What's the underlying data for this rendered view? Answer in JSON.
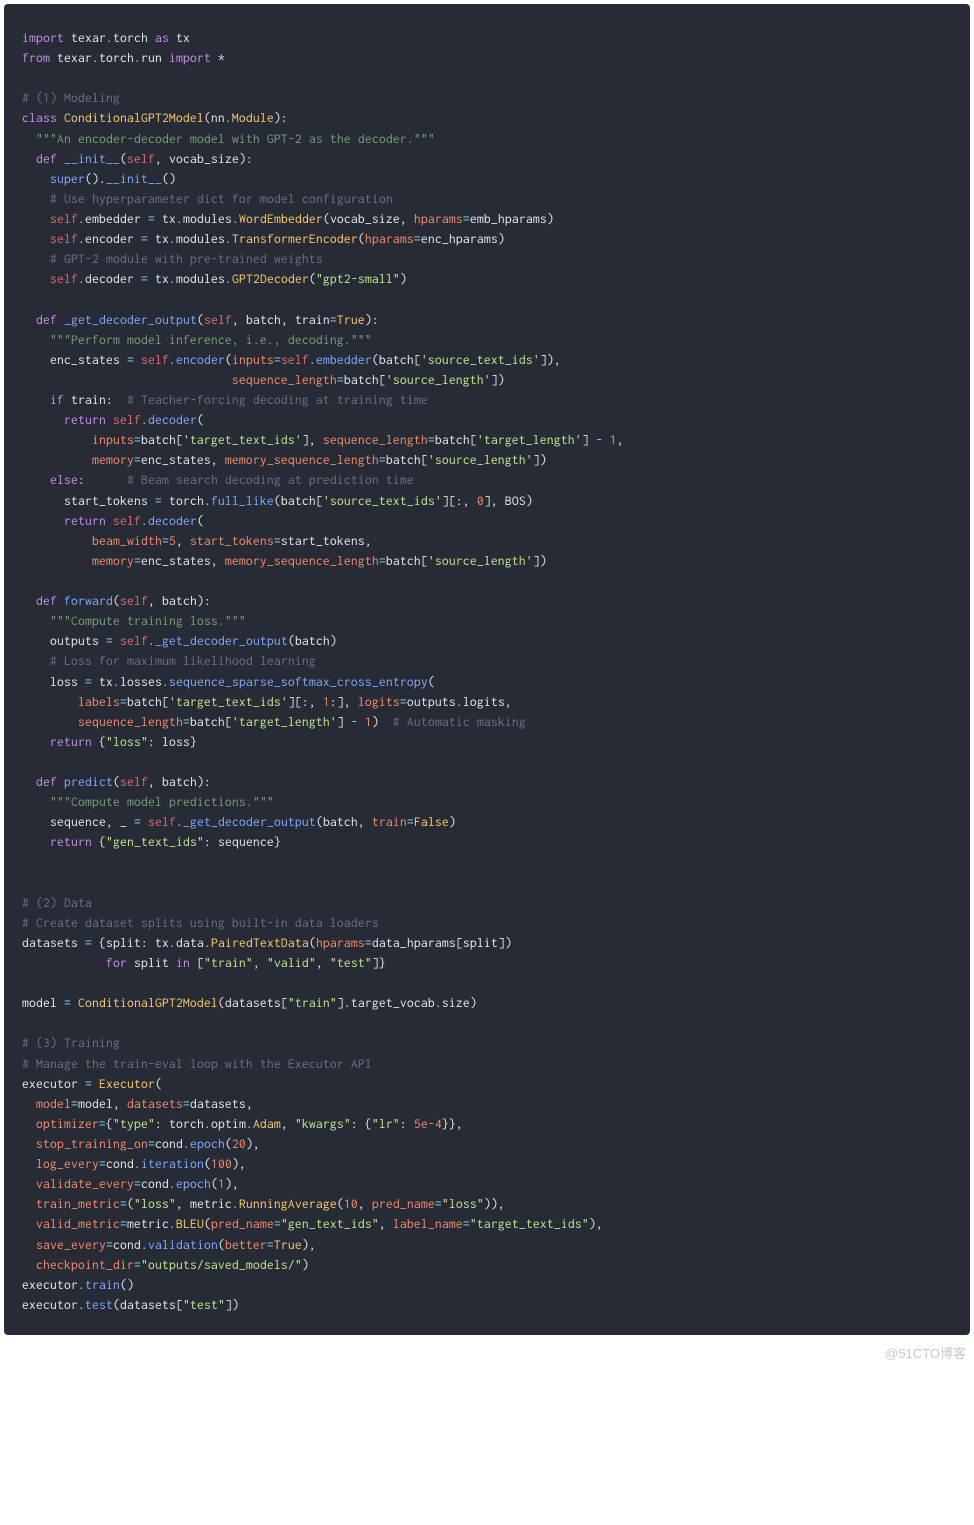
{
  "watermark": "@51CTO博客",
  "code": {
    "l01": {
      "kw1": "import",
      "id1": " texar",
      "op1": ".",
      "id2": "torch ",
      "kw2": "as",
      "id3": " tx"
    },
    "l02": {
      "kw1": "from",
      "id1": " texar",
      "op1": ".",
      "id2": "torch",
      "op2": ".",
      "id3": "run ",
      "kw2": "import",
      "id4": " *"
    },
    "l04": {
      "cmt": "# (1) Modeling"
    },
    "l05": {
      "kw": "class",
      "name": "ConditionalGPT2Model",
      "base1": "nn",
      "base2": "Module"
    },
    "l06": {
      "doc": "\"\"\"An encoder-decoder model with GPT-2 as the decoder.\"\"\""
    },
    "l07": {
      "kw": "def",
      "name": "__init__",
      "p1": "self",
      "p2": "vocab_size"
    },
    "l08": {
      "fn1": "super",
      "fn2": "__init__"
    },
    "l09": {
      "cmt": "# Use hyperparameter dict for model configuration"
    },
    "l10": {
      "lhs": "embedder",
      "m1": "tx",
      "m2": "modules",
      "m3": "WordEmbedder",
      "a1": "vocab_size",
      "kw": "hparams",
      "a2": "emb_hparams"
    },
    "l11": {
      "lhs": "encoder",
      "m1": "tx",
      "m2": "modules",
      "m3": "TransformerEncoder",
      "kw": "hparams",
      "a1": "enc_hparams"
    },
    "l12": {
      "cmt": "# GPT-2 module with pre-trained weights"
    },
    "l13": {
      "lhs": "decoder",
      "m1": "tx",
      "m2": "modules",
      "m3": "GPT2Decoder",
      "str": "\"gpt2-small\""
    },
    "l15": {
      "kw": "def",
      "name": "_get_decoder_output",
      "p1": "self",
      "p2": "batch",
      "p3": "train",
      "dv": "True"
    },
    "l16": {
      "doc": "\"\"\"Perform model inference, i.e., decoding.\"\"\""
    },
    "l17": {
      "lhs": "enc_states",
      "s": "self",
      "enc": "encoder",
      "kw1": "inputs",
      "emb": "embedder",
      "a1": "batch",
      "str1": "'source_text_ids'"
    },
    "l18": {
      "kw": "sequence_length",
      "a": "batch",
      "str": "'source_length'"
    },
    "l19": {
      "kw": "if",
      "id": "train",
      "cmt": "# Teacher-forcing decoding at training time"
    },
    "l20": {
      "kw": "return",
      "s": "self",
      "fn": "decoder"
    },
    "l21": {
      "kw1": "inputs",
      "a1": "batch",
      "str1": "'target_text_ids'",
      "kw2": "sequence_length",
      "a2": "batch",
      "str2": "'target_length'",
      "n": "1"
    },
    "l22": {
      "kw1": "memory",
      "id1": "enc_states",
      "kw2": "memory_sequence_length",
      "a": "batch",
      "str": "'source_length'"
    },
    "l23": {
      "kw": "else",
      "cmt": "# Beam search decoding at prediction time"
    },
    "l24": {
      "lhs": "start_tokens",
      "m1": "torch",
      "fn": "full_like",
      "a": "batch",
      "str": "'source_text_ids'",
      "n": "0",
      "id2": "BOS"
    },
    "l25": {
      "kw": "return",
      "s": "self",
      "fn": "decoder"
    },
    "l26": {
      "kw1": "beam_width",
      "n": "5",
      "kw2": "start_tokens",
      "id": "start_tokens"
    },
    "l27": {
      "kw1": "memory",
      "id1": "enc_states",
      "kw2": "memory_sequence_length",
      "a": "batch",
      "str": "'source_length'"
    },
    "l29": {
      "kw": "def",
      "name": "forward",
      "p1": "self",
      "p2": "batch"
    },
    "l30": {
      "doc": "\"\"\"Compute training loss.\"\"\""
    },
    "l31": {
      "lhs": "outputs",
      "s": "self",
      "fn": "_get_decoder_output",
      "a": "batch"
    },
    "l32": {
      "cmt": "# Loss for maximum likelihood learning"
    },
    "l33": {
      "lhs": "loss",
      "m1": "tx",
      "m2": "losses",
      "fn": "sequence_sparse_softmax_cross_entropy"
    },
    "l34": {
      "kw1": "labels",
      "a1": "batch",
      "str1": "'target_text_ids'",
      "n": "1",
      "kw2": "logits",
      "id2": "outputs",
      "attr": "logits"
    },
    "l35": {
      "kw": "sequence_length",
      "a": "batch",
      "str": "'target_length'",
      "n": "1",
      "cmt": "# Automatic masking"
    },
    "l36": {
      "kw": "return",
      "str": "\"loss\"",
      "id": "loss"
    },
    "l38": {
      "kw": "def",
      "name": "predict",
      "p1": "self",
      "p2": "batch"
    },
    "l39": {
      "doc": "\"\"\"Compute model predictions.\"\"\""
    },
    "l40": {
      "lhs1": "sequence",
      "lhs2": "_",
      "s": "self",
      "fn": "_get_decoder_output",
      "a": "batch",
      "kw": "train",
      "dv": "False"
    },
    "l41": {
      "kw": "return",
      "str": "\"gen_text_ids\"",
      "id": "sequence"
    },
    "l44": {
      "cmt": "# (2) Data"
    },
    "l45": {
      "cmt": "# Create dataset splits using built-in data loaders"
    },
    "l46": {
      "lhs": "datasets",
      "id1": "split",
      "m1": "tx",
      "m2": "data",
      "cls": "PairedTextData",
      "kw": "hparams",
      "id2": "data_hparams",
      "id3": "split"
    },
    "l47": {
      "kw1": "for",
      "id": "split",
      "kw2": "in",
      "s1": "\"train\"",
      "s2": "\"valid\"",
      "s3": "\"test\""
    },
    "l49": {
      "lhs": "model",
      "cls": "ConditionalGPT2Model",
      "id": "datasets",
      "str": "\"train\"",
      "a1": "target_vocab",
      "a2": "size"
    },
    "l51": {
      "cmt": "# (3) Training"
    },
    "l52": {
      "cmt": "# Manage the train-eval loop with the Executor API"
    },
    "l53": {
      "lhs": "executor",
      "cls": "Executor"
    },
    "l54": {
      "kw1": "model",
      "id1": "model",
      "kw2": "datasets",
      "id2": "datasets"
    },
    "l55": {
      "kw1": "optimizer",
      "s1": "\"type\"",
      "m1": "torch",
      "m2": "optim",
      "cls": "Adam",
      "s2": "\"kwargs\"",
      "s3": "\"lr\"",
      "n": "5e-4"
    },
    "l56": {
      "kw": "stop_training_on",
      "id": "cond",
      "fn": "epoch",
      "n": "20"
    },
    "l57": {
      "kw": "log_every",
      "id": "cond",
      "fn": "iteration",
      "n": "100"
    },
    "l58": {
      "kw": "validate_every",
      "id": "cond",
      "fn": "epoch",
      "n": "1"
    },
    "l59": {
      "kw": "train_metric",
      "s": "\"loss\"",
      "id": "metric",
      "cls": "RunningAverage",
      "n": "10",
      "kw2": "pred_name",
      "s2": "\"loss\""
    },
    "l60": {
      "kw": "valid_metric",
      "id": "metric",
      "cls": "BLEU",
      "kw2": "pred_name",
      "s2": "\"gen_text_ids\"",
      "kw3": "label_name",
      "s3": "\"target_text_ids\""
    },
    "l61": {
      "kw": "save_every",
      "id": "cond",
      "fn": "validation",
      "kw2": "better",
      "dv": "True"
    },
    "l62": {
      "kw": "checkpoint_dir",
      "str": "\"outputs/saved_models/\""
    },
    "l63": {
      "id": "executor",
      "fn": "train"
    },
    "l64": {
      "id": "executor",
      "fn": "test",
      "a": "datasets",
      "str": "\"test\""
    }
  }
}
